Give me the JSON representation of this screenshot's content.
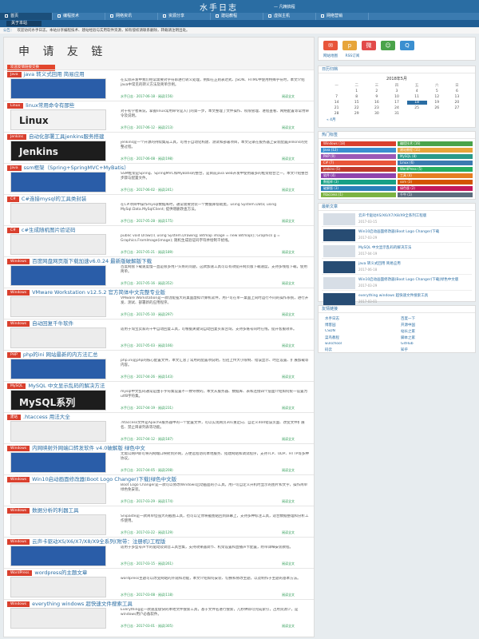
{
  "site": {
    "title": "水手日志",
    "subtitle": "— 凡精搞程"
  },
  "nav": {
    "items": [
      {
        "label": "首页"
      },
      {
        "label": "编程技术"
      },
      {
        "label": "网络资讯"
      },
      {
        "label": "资源分享"
      },
      {
        "label": "建站教程"
      },
      {
        "label": "虚拟主机"
      },
      {
        "label": "网络营销"
      }
    ],
    "sub_item": "关于本站"
  },
  "notice": {
    "label": "公告：",
    "text": "欢迎访问水手日志，本站分享编程技术、建站经验与实用软件资源，如有侵权请联系删除，转载请注明出处。"
  },
  "banner": {
    "title": "申 请 友 链",
    "tag": "欢迎友情链接交换"
  },
  "posts": [
    {
      "category": "Java",
      "title": "java 转义式回用 简易应用",
      "thumb": "",
      "excerpt": "在实际开发中我们经常需要对字符串进行转义处理，例如在正则表达式、JSON、HTML中使用特殊字符时，本文介绍java中常见的转义方法及简单示例。",
      "meta": "水手日志 · 2017-06-18 · 阅读(156)",
      "more": "阅读全文"
    },
    {
      "category": "Linux",
      "title": "linux常用命令有那些",
      "thumb": "Linux",
      "excerpt": "对于初学者来说，掌握linux常用命令是入门的第一步，本文整理了文件操作、权限管理、进程查看、网络配置等常用命令及说明。",
      "meta": "水手日志 · 2017-06-12 · 阅读(213)",
      "more": "阅读全文"
    },
    {
      "category": "Jenkins",
      "title": "自动化部署工具jenkins服务搭建",
      "thumb": "Jenkins",
      "excerpt": "jenkins是一个开源的持续集成工具，可用于自动化构建、测试和部署项目，本文记录在服务器上安装配置jenkins的完整过程。",
      "meta": "水手日志 · 2017-06-08 · 阅读(198)",
      "more": "阅读全文"
    },
    {
      "category": "Java",
      "title": "ssm框架（Spring+SpringMVC+MyBatis）",
      "thumb": "",
      "excerpt": "SSM框架是Spring、SpringMVC和MyBatis的整合，是目前java web开发中使用最多的框架组合之一，本文介绍整合步骤与配置文件。",
      "meta": "水手日志 · 2017-06-02 · 阅读(241)",
      "more": "阅读全文"
    },
    {
      "category": "C#",
      "title": "C#连接mysql的工具类封装",
      "thumb": "",
      "excerpt": "在C#项目中操作mysql数据库时，通常需要封装一个数据库帮助类，using System.Data; using MySql.Data.MySqlClient; 提供增删改查方法。",
      "meta": "水手日志 · 2017-05-28 · 阅读(175)",
      "more": "阅读全文"
    },
    {
      "category": "C#",
      "title": "c#生成随机图片验证码",
      "thumb": "",
      "excerpt": "public void Draw(){ using System.Drawing; Bitmap image = new Bitmap(); Graphics g = Graphics.FromImage(image); 随机生成验证码字符并绘制干扰线。",
      "meta": "水手日志 · 2017-05-21 · 阅读(189)",
      "more": "阅读全文"
    },
    {
      "category": "Windows",
      "title": "百度网盘网页版下载加速v6.0.24 最新版破解版下载",
      "thumb": "",
      "excerpt": "百度网盘下载速度慢一直是很多用户头疼的问题，这款加速工具可以有效提升网页版下载速度，支持多线程下载，使用简单。",
      "meta": "水手日志 · 2017-05-16 · 阅读(352)",
      "more": "阅读全文"
    },
    {
      "category": "Windows",
      "title": "VMware Workstation v12.5.2 官方简体中文完整专业版",
      "thumb": "",
      "excerpt": "VMware Workstation是一款功能强大的桌面虚拟计算机软件，用户可在单一桌面上同时运行不同的操作系统，进行开发、测试、部署新的应用程序。",
      "meta": "水手日志 · 2017-05-10 · 阅读(297)",
      "more": "阅读全文"
    },
    {
      "category": "Windows",
      "title": "自动回复千牛软件",
      "thumb": "",
      "excerpt": "适用于淘宝卖家的千牛自动回复工具，可根据关键词自动回复买家咨询，支持多账号同时在线，提升客服效率。",
      "meta": "水手日志 · 2017-05-03 · 阅读(166)",
      "more": "阅读全文"
    },
    {
      "category": "PHP",
      "title": "php的ini 网站最新的内方法汇总",
      "thumb": "",
      "excerpt": "php.ini是php的核心配置文件，本文汇总了常用的配置项说明，包括上传大小限制、错误显示、时区设置、扩展加载等内容。",
      "meta": "水手日志 · 2017-04-26 · 阅读(143)",
      "more": "阅读全文"
    },
    {
      "category": "MySQL",
      "title": "MySQL 中文显示乱码的解决方法",
      "thumb": "MySQL系列",
      "excerpt": "mysql中文乱码通常是由于字符集设置不一致导致的，本文从服务器、数据库、表和连接四个层面介绍如何统一设置为utf8字符集。",
      "meta": "水手日志 · 2017-04-19 · 阅读(231)",
      "more": "阅读全文"
    },
    {
      "category": "建站",
      "title": ".htaccess 用法大全",
      "thumb": "",
      "excerpt": ".htaccess文件是Apache服务器中的一个配置文件，可以实现网页301重定向、自定义404错误页面、改变文件扩展名、禁止目录列表等功能。",
      "meta": "水手日志 · 2017-04-12 · 阅读(187)",
      "more": "阅读全文"
    },
    {
      "category": "Windows",
      "title": "内网映射外网端口转发软件 v4.0破解版 绿色中文",
      "thumb": "",
      "excerpt": "无需公网IP即可将内网端口映射到外网，方便远程访问本地服务、搭建网站和调试程序，支持TCP、UDP、HTTP等多种协议。",
      "meta": "水手日志 · 2017-04-05 · 阅读(208)",
      "more": "阅读全文"
    },
    {
      "category": "Windows",
      "title": "Win10启动画面修改器(Boot Logo Changer)下载|绿色中文版",
      "thumb": "",
      "excerpt": "Boot Logo Changer是一款可以修改Windows启动画面的小工具，用户可自定义开机时显示的图片和文字，操作简单绿色免安装。",
      "meta": "水手日志 · 2017-03-29 · 阅读(174)",
      "more": "阅读全文"
    },
    {
      "category": "Windows",
      "title": "数据分析的利器工具",
      "thumb": "",
      "excerpt": "Snipaste是一款简单但强大的截图工具，也可以让你将截图贴回到屏幕上，支持多种标注工具，适合数据整理和分析工作使用。",
      "meta": "水手日志 · 2017-03-22 · 阅读(129)",
      "more": "阅读全文"
    },
    {
      "category": "Windows",
      "title": "云声卡驱动XS/X6/X7/X8/X9全系列(附带：注册机)工程版",
      "thumb": "",
      "excerpt": "适用于多型号声卡的驱动及调音工具合集，支持效果器调节、机架设置和直播声卡配置，附带详细安装教程。",
      "meta": "水手日志 · 2017-03-15 · 阅读(261)",
      "more": "阅读全文"
    },
    {
      "category": "WordPress",
      "title": "wordpress的主题文章",
      "thumb": "",
      "excerpt": "wordpress主题可以改变网站的外观和功能，本文介绍如何安装、切换和修改主题，以及制作子主题的基本方法。",
      "meta": "水手日志 · 2017-03-08 · 阅读(118)",
      "more": "阅读全文"
    },
    {
      "category": "Windows",
      "title": "everything windows 超快速文件搜索工具",
      "thumb": "",
      "excerpt": "Everything是一款速度极快的本地文件搜索工具，基于文件名进行搜索，几秒钟即可完成索引，占用资源少，是windows用户必备软件。",
      "meta": "水手日志 · 2017-03-01 · 阅读(305)",
      "more": "阅读全文"
    }
  ],
  "sidebar": {
    "social_title": "",
    "social": [
      {
        "glyph": "✉",
        "color": "#e8553a"
      },
      {
        "glyph": "p",
        "color": "#e7a53a"
      },
      {
        "glyph": "微",
        "color": "#e24a4a"
      },
      {
        "glyph": "☺",
        "color": "#4aa34a"
      },
      {
        "glyph": "Q",
        "color": "#3b8fd0"
      }
    ],
    "links": {
      "a": "网站地图",
      "b": "RSS订阅"
    },
    "calendar_box": "日历归档",
    "calendar": {
      "title": "2018年5月",
      "headers": [
        "一",
        "二",
        "三",
        "四",
        "五",
        "六",
        "日"
      ],
      "days": [
        "",
        "1",
        "2",
        "3",
        "4",
        "5",
        "6",
        "7",
        "8",
        "9",
        "10",
        "11",
        "12",
        "13",
        "14",
        "15",
        "16",
        "17",
        "18",
        "19",
        "20",
        "21",
        "22",
        "23",
        "24",
        "25",
        "26",
        "27",
        "28",
        "29",
        "30",
        "31",
        "",
        "",
        ""
      ],
      "today": "18",
      "prev": "« 4月"
    },
    "tags_title": "热门标签",
    "tags": [
      {
        "label": "Windows (18)",
        "color": "#d9402e"
      },
      {
        "label": "编程技术 (16)",
        "color": "#4aa34a"
      },
      {
        "label": "Java (12)",
        "color": "#3b8fd0"
      },
      {
        "label": "建站教程 (11)",
        "color": "#e7a53a"
      },
      {
        "label": "PHP (9)",
        "color": "#9b59b6"
      },
      {
        "label": "MySQL (8)",
        "color": "#2a9a8a"
      },
      {
        "label": "C# (7)",
        "color": "#e8553a"
      },
      {
        "label": "Linux (6)",
        "color": "#3b7bb0"
      },
      {
        "label": "jenkins (5)",
        "color": "#c0392b"
      },
      {
        "label": "WordPress (5)",
        "color": "#27ae60"
      },
      {
        "label": "软件 (4)",
        "color": "#8e44ad"
      },
      {
        "label": "工具 (4)",
        "color": "#e67e22"
      },
      {
        "label": "数据库 (3)",
        "color": "#16a085"
      },
      {
        "label": "ssm (3)",
        "color": "#d35400"
      },
      {
        "label": "破解版 (3)",
        "color": "#2980b9"
      },
      {
        "label": "绿色版 (2)",
        "color": "#c2185b"
      },
      {
        "label": "htaccess (1)",
        "color": "#7cb342"
      },
      {
        "label": "千牛 (1)",
        "color": "#5d6d7e"
      }
    ],
    "recent_title": "最新文章",
    "recent": [
      {
        "title": "云声卡驱动XS/X6/X7/X8/X9全系列工程版",
        "date": "2017-03-15"
      },
      {
        "title": "Win10启动画面修改器(Boot Logo Changer)下载",
        "date": "2017-03-29"
      },
      {
        "title": "MySQL 中文显示乱码的解决方法",
        "date": "2017-04-19"
      },
      {
        "title": "java 转义式回用 简易应用",
        "date": "2017-06-18"
      },
      {
        "title": "Win10启动画面修改器(Boot Logo Changer)下载|绿色中文版",
        "date": "2017-03-29"
      },
      {
        "title": "everything windows 超快速文件搜索工具",
        "date": "2017-03-01"
      }
    ],
    "friends_title": "友情链接",
    "friends": [
      "水手日志",
      "百度一下",
      "博客园",
      "开源中国",
      "CSDN",
      "站长之家",
      "菜鸟教程",
      "脚本之家",
      "w3school",
      "GitHub",
      "码云",
      "知乎"
    ]
  }
}
